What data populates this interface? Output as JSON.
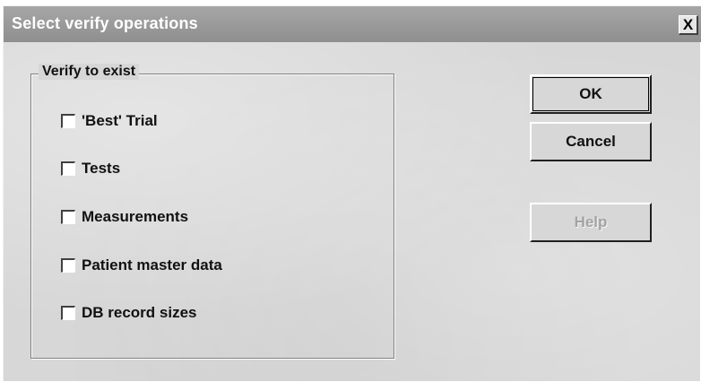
{
  "dialog": {
    "title": "Select verify operations",
    "close_glyph": "X"
  },
  "group": {
    "legend": "Verify to exist",
    "options": [
      {
        "label": "'Best' Trial",
        "checked": false
      },
      {
        "label": "Tests",
        "checked": false
      },
      {
        "label": "Measurements",
        "checked": false
      },
      {
        "label": "Patient master data",
        "checked": false
      },
      {
        "label": "DB record sizes",
        "checked": false
      }
    ]
  },
  "buttons": {
    "ok": "OK",
    "cancel": "Cancel",
    "help": "Help"
  }
}
